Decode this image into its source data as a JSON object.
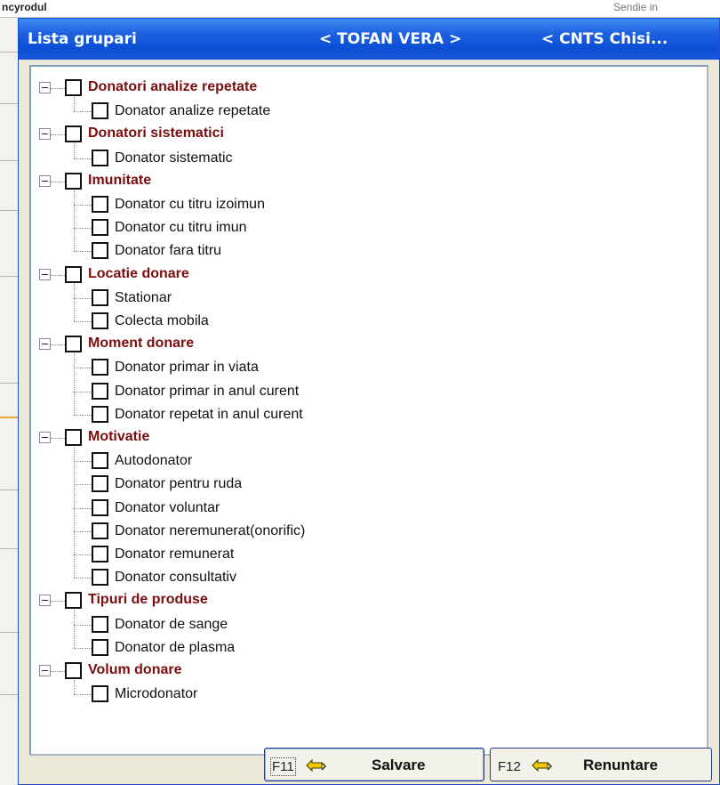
{
  "background": {
    "left_text": "ncyrodul",
    "right_text": "Sendie in"
  },
  "titlebar": {
    "title": "Lista grupari",
    "user": "< TOFAN VERA >",
    "org": "< CNTS Chisi..."
  },
  "tree": [
    {
      "label": "Donatori analize repetate",
      "children": [
        "Donator analize repetate"
      ]
    },
    {
      "label": "Donatori sistematici",
      "children": [
        "Donator sistematic"
      ]
    },
    {
      "label": "Imunitate",
      "children": [
        "Donator cu titru izoimun",
        "Donator cu titru imun",
        "Donator fara titru"
      ]
    },
    {
      "label": "Locatie donare",
      "children": [
        "Stationar",
        "Colecta mobila"
      ]
    },
    {
      "label": "Moment donare",
      "children": [
        "Donator primar in viata",
        "Donator primar in anul curent",
        "Donator repetat in anul curent"
      ]
    },
    {
      "label": "Motivatie",
      "children": [
        "Autodonator",
        "Donator pentru ruda",
        "Donator voluntar",
        "Donator neremunerat(onorific)",
        "Donator remunerat",
        "Donator consultativ"
      ]
    },
    {
      "label": "Tipuri de produse",
      "children": [
        "Donator de sange",
        "Donator de plasma"
      ]
    },
    {
      "label": "Volum donare",
      "children": [
        "Microdonator"
      ]
    }
  ],
  "buttons": {
    "save": {
      "key": "F11",
      "label": "Salvare",
      "icon": "save-arrow-icon"
    },
    "cancel": {
      "key": "F12",
      "label": "Renuntare",
      "icon": "cancel-arrow-icon"
    }
  },
  "colors": {
    "title_bar": "#0b4fd6",
    "category_text": "#7a0e0e",
    "dialog_face": "#ece9d8"
  }
}
